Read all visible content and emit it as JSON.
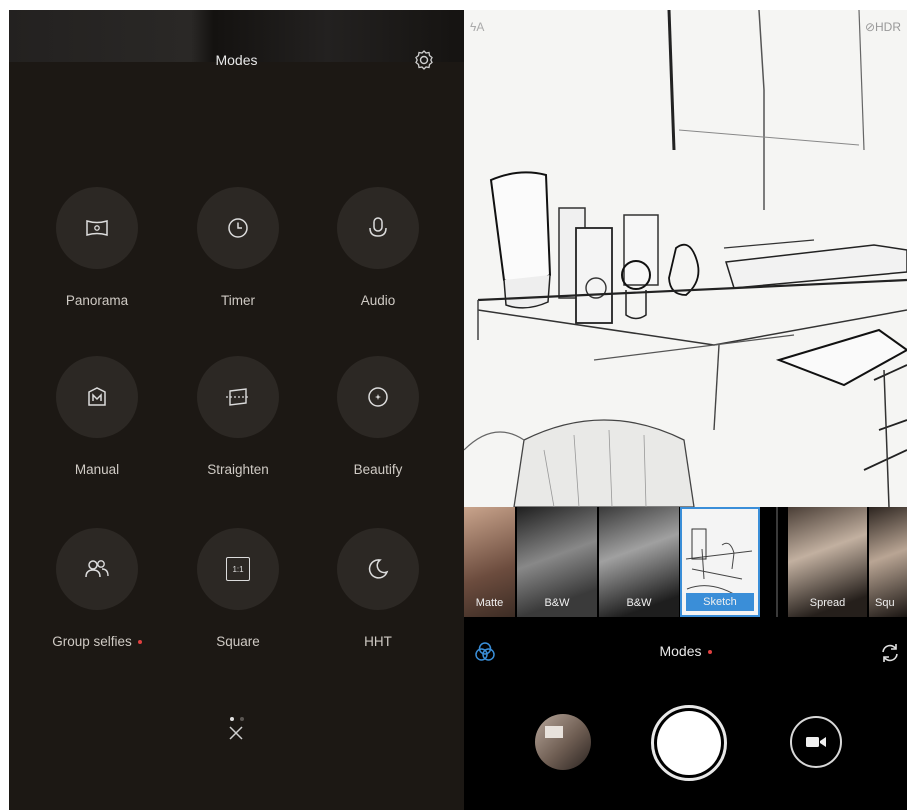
{
  "modes_panel": {
    "title": "Modes",
    "items": [
      {
        "label": "Panorama",
        "icon": "panorama-icon",
        "has_dot": false
      },
      {
        "label": "Timer",
        "icon": "timer-icon",
        "has_dot": false
      },
      {
        "label": "Audio",
        "icon": "audio-icon",
        "has_dot": false
      },
      {
        "label": "Manual",
        "icon": "manual-icon",
        "has_dot": false
      },
      {
        "label": "Straighten",
        "icon": "straighten-icon",
        "has_dot": false
      },
      {
        "label": "Beautify",
        "icon": "beautify-icon",
        "has_dot": false
      },
      {
        "label": "Group selfies",
        "icon": "group-selfies-icon",
        "has_dot": true
      },
      {
        "label": "Square",
        "icon": "square-icon",
        "has_dot": false
      },
      {
        "label": "HHT",
        "icon": "hht-icon",
        "has_dot": false
      }
    ],
    "square_icon_text": "1:1",
    "pager": {
      "pages": 2,
      "current": 1
    }
  },
  "camera": {
    "flash_label": "ϟA",
    "hdr_label": "⊘HDR",
    "filters": [
      {
        "label": "Matte",
        "selected": false
      },
      {
        "label": "B&W",
        "selected": false
      },
      {
        "label": "B&W",
        "selected": false
      },
      {
        "label": "Sketch",
        "selected": true
      },
      {
        "label": "Spread",
        "selected": false
      },
      {
        "label": "Squ",
        "selected": false
      }
    ],
    "modes_label": "Modes"
  },
  "colors": {
    "panel_bg": "#1c1814",
    "circle_bg": "#2c2824",
    "accent_blue": "#3a8ed8",
    "red_dot": "#e04040"
  }
}
